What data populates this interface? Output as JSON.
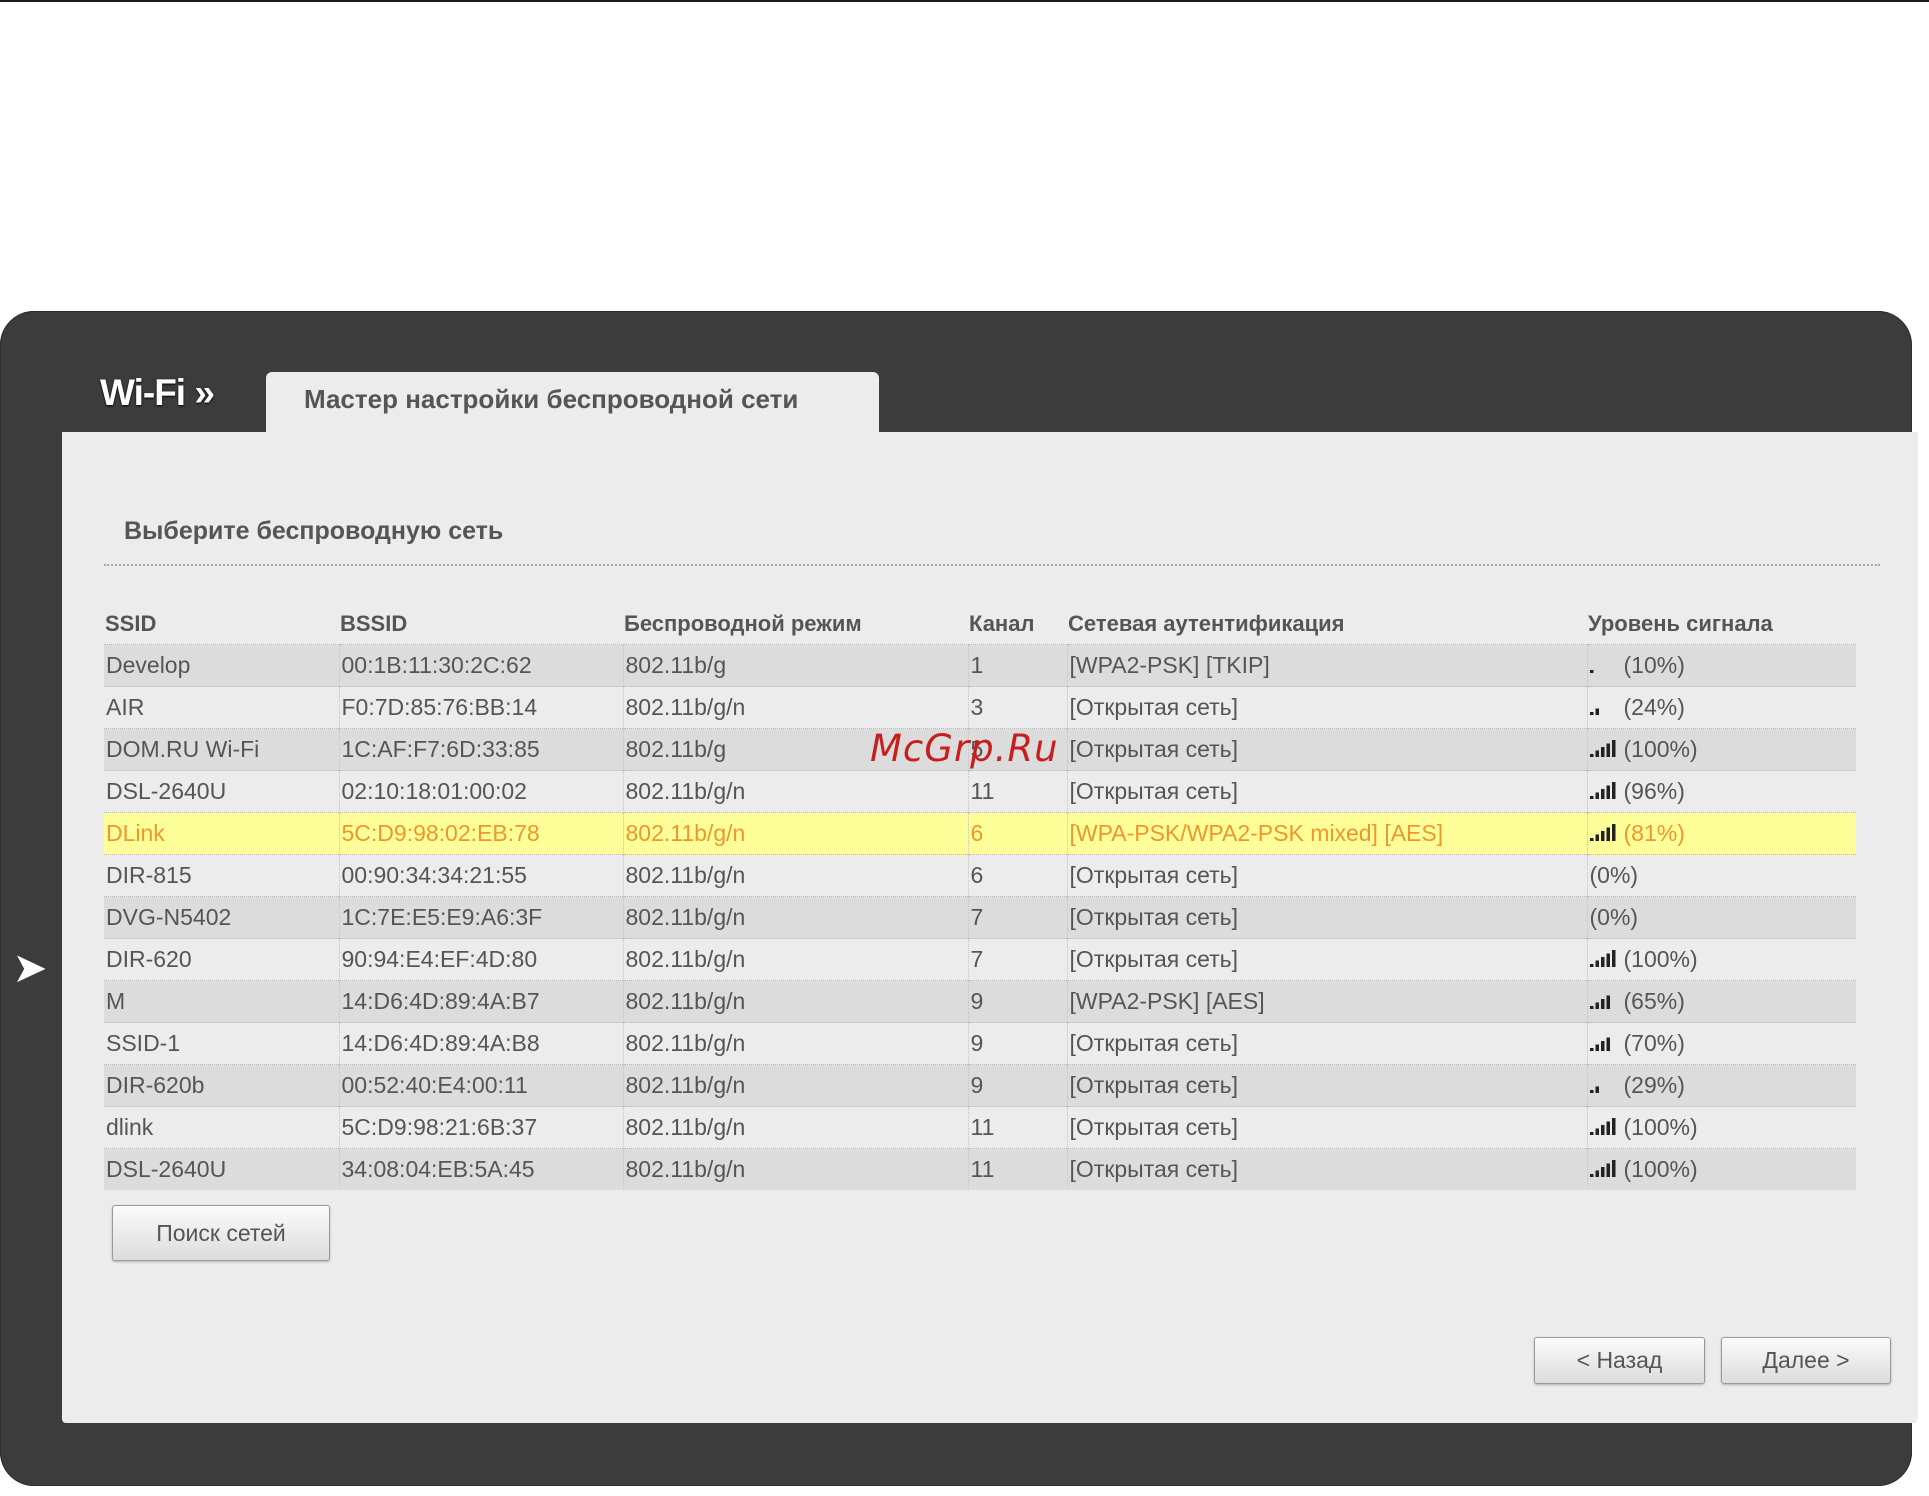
{
  "header": {
    "section_title": "Wi-Fi »",
    "tab_label": "Мастер настройки беспроводной сети"
  },
  "panel": {
    "heading": "Выберите беспроводную сеть"
  },
  "table": {
    "columns": [
      "SSID",
      "BSSID",
      "Беспроводной режим",
      "Канал",
      "Сетевая аутентификация",
      "Уровень сигнала"
    ],
    "rows": [
      {
        "ssid": "Develop",
        "bssid": "00:1B:11:30:2C:62",
        "mode": "802.11b/g",
        "channel": "1",
        "auth": "[WPA2-PSK] [TKIP]",
        "signal": "(10%)",
        "signal_bars": 1
      },
      {
        "ssid": "AIR",
        "bssid": "F0:7D:85:76:BB:14",
        "mode": "802.11b/g/n",
        "channel": "3",
        "auth": "[Открытая сеть]",
        "signal": "(24%)",
        "signal_bars": 2
      },
      {
        "ssid": "DOM.RU Wi-Fi",
        "bssid": "1C:AF:F7:6D:33:85",
        "mode": "802.11b/g",
        "channel": "5",
        "auth": "[Открытая сеть]",
        "signal": "(100%)",
        "signal_bars": 5
      },
      {
        "ssid": "DSL-2640U",
        "bssid": "02:10:18:01:00:02",
        "mode": "802.11b/g/n",
        "channel": "11",
        "auth": "[Открытая сеть]",
        "signal": "(96%)",
        "signal_bars": 5
      },
      {
        "ssid": "DLink",
        "bssid": "5C:D9:98:02:EB:78",
        "mode": "802.11b/g/n",
        "channel": "6",
        "auth": "[WPA-PSK/WPA2-PSK mixed] [AES]",
        "signal": "(81%)",
        "signal_bars": 5
      },
      {
        "ssid": "DIR-815",
        "bssid": "00:90:34:34:21:55",
        "mode": "802.11b/g/n",
        "channel": "6",
        "auth": "[Открытая сеть]",
        "signal": "(0%)",
        "signal_bars": 0
      },
      {
        "ssid": "DVG-N5402",
        "bssid": "1C:7E:E5:E9:A6:3F",
        "mode": "802.11b/g/n",
        "channel": "7",
        "auth": "[Открытая сеть]",
        "signal": "(0%)",
        "signal_bars": 0
      },
      {
        "ssid": "DIR-620",
        "bssid": "90:94:E4:EF:4D:80",
        "mode": "802.11b/g/n",
        "channel": "7",
        "auth": "[Открытая сеть]",
        "signal": "(100%)",
        "signal_bars": 5
      },
      {
        "ssid": "M",
        "bssid": "14:D6:4D:89:4A:B7",
        "mode": "802.11b/g/n",
        "channel": "9",
        "auth": "[WPA2-PSK] [AES]",
        "signal": "(65%)",
        "signal_bars": 4
      },
      {
        "ssid": "SSID-1",
        "bssid": "14:D6:4D:89:4A:B8",
        "mode": "802.11b/g/n",
        "channel": "9",
        "auth": "[Открытая сеть]",
        "signal": "(70%)",
        "signal_bars": 4
      },
      {
        "ssid": "DIR-620b",
        "bssid": "00:52:40:E4:00:11",
        "mode": "802.11b/g/n",
        "channel": "9",
        "auth": "[Открытая сеть]",
        "signal": "(29%)",
        "signal_bars": 2
      },
      {
        "ssid": "dlink",
        "bssid": "5C:D9:98:21:6B:37",
        "mode": "802.11b/g/n",
        "channel": "11",
        "auth": "[Открытая сеть]",
        "signal": "(100%)",
        "signal_bars": 5
      },
      {
        "ssid": "DSL-2640U",
        "bssid": "34:08:04:EB:5A:45",
        "mode": "802.11b/g/n",
        "channel": "11",
        "auth": "[Открытая сеть]",
        "signal": "(100%)",
        "signal_bars": 5
      }
    ],
    "selected_row": 4
  },
  "buttons": {
    "scan": "Поиск сетей",
    "back": "< Назад",
    "next": "Далее >"
  },
  "watermark": "McGrp.Ru",
  "icons": {
    "nav_left": "arrow-left-icon",
    "signal": "signal-strength-icon"
  },
  "colors": {
    "frame": "#3c3c3c",
    "panel": "#ececec",
    "selected_row_bg": "#ffff99",
    "selected_row_text": "#f0962c",
    "watermark": "#c81e1e"
  }
}
